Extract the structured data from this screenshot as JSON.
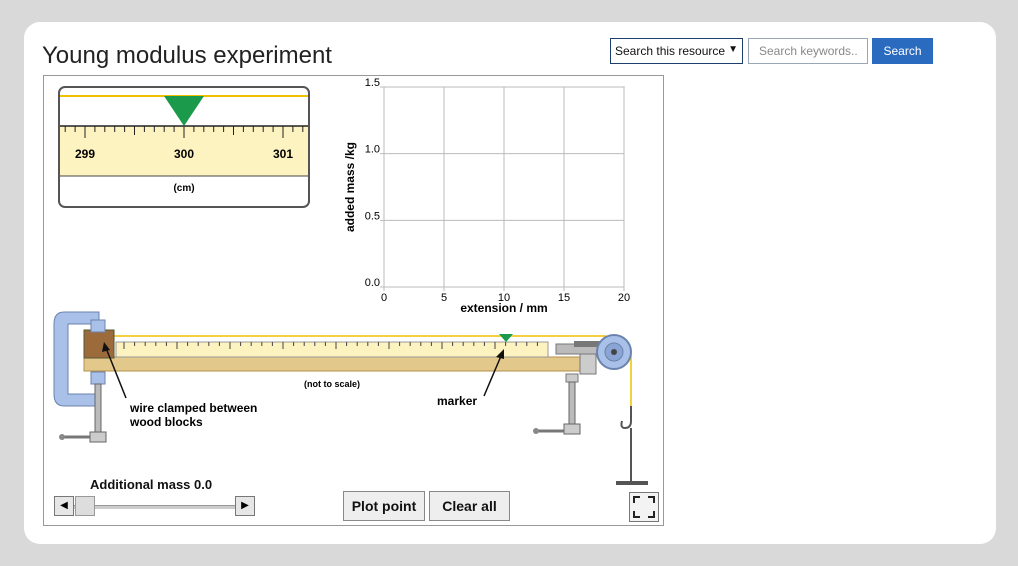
{
  "page": {
    "title": "Young modulus experiment"
  },
  "search": {
    "scope": "Search this resource",
    "placeholder": "Search keywords..",
    "button": "Search"
  },
  "scale": {
    "ticks": [
      "299",
      "300",
      "301"
    ],
    "unit": "(cm)"
  },
  "chart_data": {
    "type": "scatter",
    "xlabel": "extension / mm",
    "ylabel": "added mass /kg",
    "xlim": [
      0,
      20
    ],
    "ylim": [
      0,
      1.5
    ],
    "x_ticks": [
      "0",
      "5",
      "10",
      "15",
      "20"
    ],
    "y_ticks": [
      "0.0",
      "0.5",
      "1.0",
      "1.5"
    ],
    "grid": true,
    "points": []
  },
  "apparatus": {
    "not_to_scale": "(not to scale)",
    "clamp_label_1": "wire clamped between",
    "clamp_label_2": "wood blocks",
    "marker_label": "marker"
  },
  "controls": {
    "mass_label": "Additional mass 0.0",
    "additional_mass": 0.0,
    "plot_button": "Plot point",
    "clear_button": "Clear all"
  },
  "colors": {
    "wire": "#f0c000",
    "marker": "#1a9a4a",
    "clamp": "#a9c0e8",
    "wood": "#e2c88a",
    "button": "#2a6bbf"
  }
}
